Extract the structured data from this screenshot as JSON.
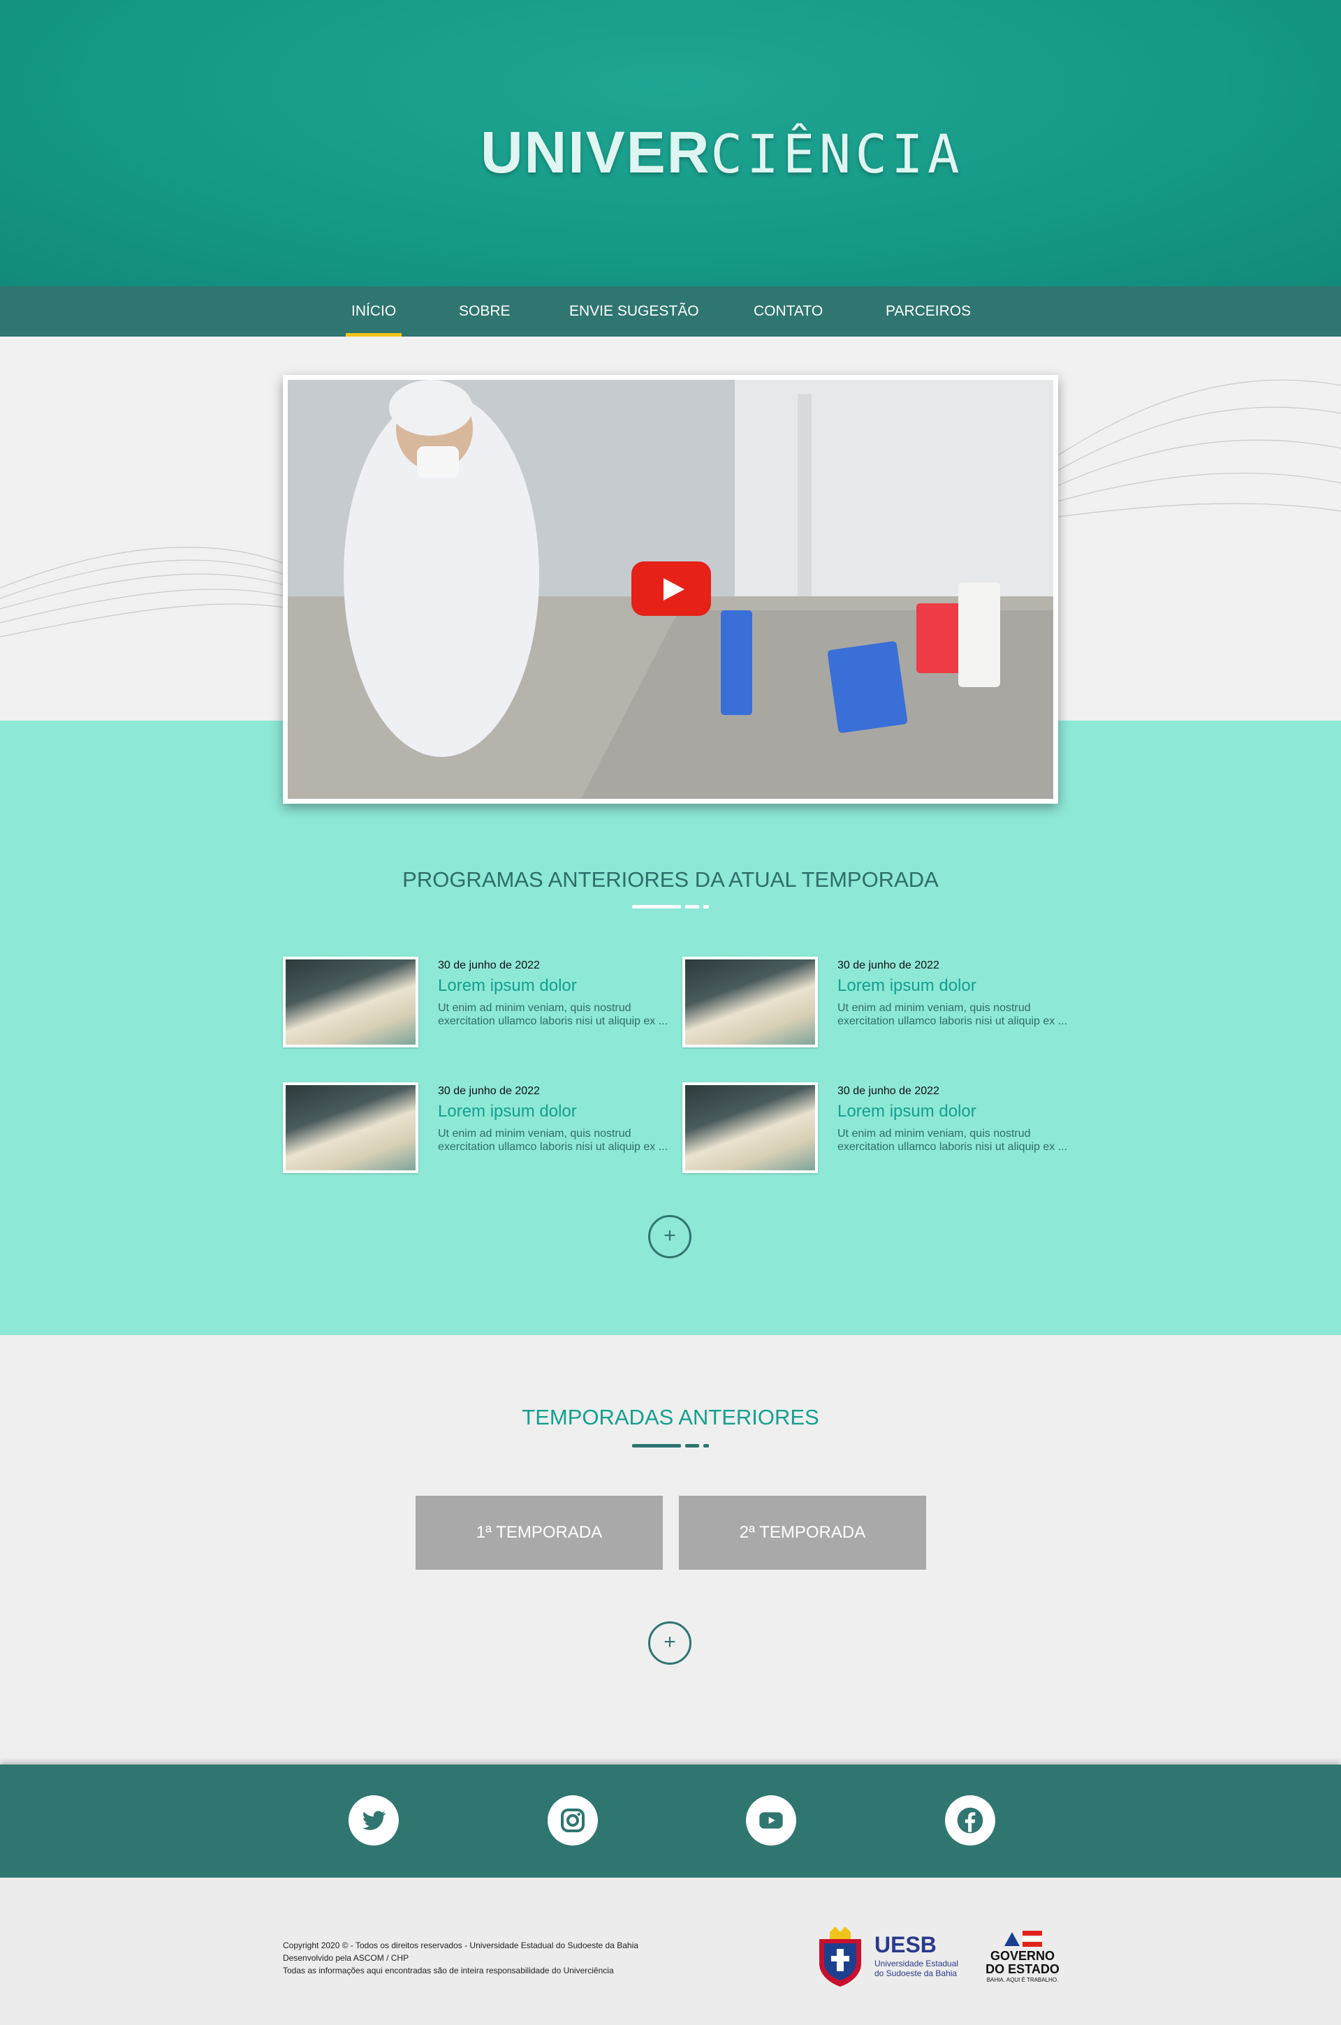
{
  "header": {
    "logo_bold": "UNIVER",
    "logo_light": "CIÊNCIA"
  },
  "nav": {
    "items": [
      "INÍCIO",
      "SOBRE",
      "ENVIE SUGESTÃO",
      "CONTATO",
      "PARCEIROS"
    ],
    "active": "INÍCIO"
  },
  "hero": {
    "video_icon": "play-icon"
  },
  "programs": {
    "title": "PROGRAMAS ANTERIORES DA ATUAL TEMPORADA",
    "cards": [
      {
        "date": "30 de junho de 2022",
        "title": "Lorem ipsum dolor",
        "text": "Ut enim ad minim veniam, quis nostrud exercitation ullamco laboris nisi ut aliquip ex ..."
      },
      {
        "date": "30 de junho de 2022",
        "title": "Lorem ipsum dolor",
        "text": "Ut enim ad minim veniam, quis nostrud exercitation ullamco laboris nisi ut aliquip ex ..."
      },
      {
        "date": "30 de junho de 2022",
        "title": "Lorem ipsum dolor",
        "text": "Ut enim ad minim veniam, quis nostrud exercitation ullamco laboris nisi ut aliquip ex ..."
      },
      {
        "date": "30 de junho de 2022",
        "title": "Lorem ipsum dolor",
        "text": "Ut enim ad minim veniam, quis nostrud exercitation ullamco laboris nisi ut aliquip ex ..."
      }
    ],
    "more": "+"
  },
  "seasons": {
    "title": "TEMPORADAS ANTERIORES",
    "buttons": [
      "1ª TEMPORADA",
      "2ª TEMPORADA"
    ],
    "more": "+"
  },
  "social": {
    "icons": [
      "twitter-icon",
      "instagram-icon",
      "youtube-icon",
      "facebook-icon"
    ]
  },
  "footer": {
    "lines": [
      "Copyright 2020 © - Todos os direitos reservados - Universidade Estadual do Sudoeste da Bahia",
      "Desenvolvido pela ASCOM / CHP",
      "Todas as informações aqui encontradas são de inteira responsabilidade do Univerciência"
    ],
    "uesb": {
      "abbr": "UESB",
      "name_line1": "Universidade Estadual",
      "name_line2": "do Sudoeste da Bahia"
    },
    "gov": {
      "line1": "GOVERNO",
      "line2": "DO ESTADO",
      "tagline": "BAHIA. AQUI É TRABALHO."
    }
  },
  "colors": {
    "teal": "#169a88",
    "nav": "#2f7570",
    "mint": "#8ee8d6",
    "accent": "#f0c419",
    "title_teal": "#13a08d",
    "play_red": "#e62117"
  }
}
